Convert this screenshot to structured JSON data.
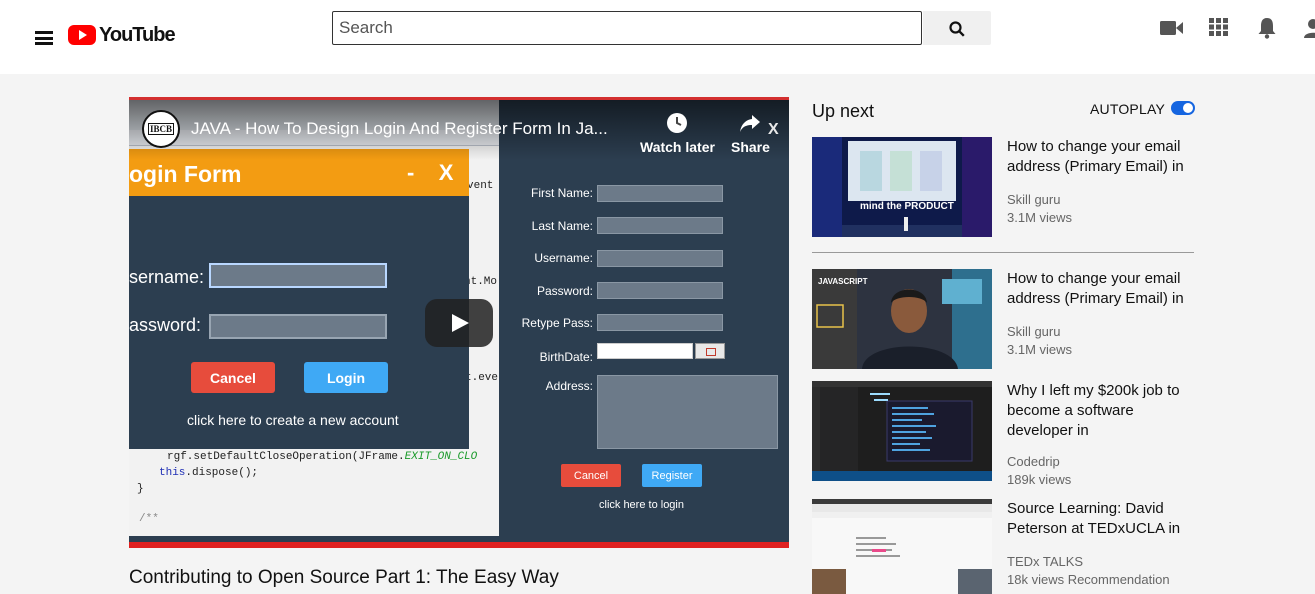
{
  "header": {
    "logo_text": "YouTube",
    "search_placeholder": "Search",
    "icons": [
      "menu-icon",
      "search-icon",
      "video-camera-icon",
      "apps-grid-icon",
      "bell-icon",
      "account-icon"
    ]
  },
  "player": {
    "video_title": "JAVA - How To Design Login And Register Form In Ja...",
    "channel_badge": "IBCB",
    "watch_later_label": "Watch later",
    "share_label": "Share",
    "close_label": "X",
    "ide_code": {
      "snippet1": "rgf.setDefaultCloseOperation(JFrame.",
      "snippet1_constant": "EXIT_ON_CLO",
      "snippet2_kw": "this",
      "snippet2_rest": ".dispose();",
      "snippet3": "}",
      "snippet4": "/**",
      "side1": "vent",
      "side2": "nt.Mo",
      "side3": "t.eve"
    },
    "login_form": {
      "title": "ogin Form",
      "window_controls": "-    X",
      "username_label": "sername:",
      "password_label": "assword:",
      "cancel_label": "Cancel",
      "login_label": "Login",
      "create_account_link": "click here to create a new account"
    },
    "register_form": {
      "first_name_label": "First Name:",
      "last_name_label": "Last Name:",
      "username_label": "Username:",
      "password_label": "Password:",
      "retype_pass_label": "Retype Pass:",
      "birthdate_label": "BirthDate:",
      "address_label": "Address:",
      "cancel_label": "Cancel",
      "register_label": "Register",
      "login_link": "click here to login"
    }
  },
  "main": {
    "video_title": "Contributing to Open Source Part 1: The Easy Way"
  },
  "sidebar": {
    "up_next_label": "Up next",
    "autoplay_label": "AUTOPLAY",
    "autoplay_on": true,
    "recommendations": [
      {
        "title": "How to change your email address (Primary Email) in",
        "channel": "Skill guru",
        "views": "3.1M views",
        "thumb_text": "mind the PRODUCT"
      },
      {
        "title": "How to change your email address (Primary Email) in",
        "channel": "Skill guru",
        "views": "3.1M views",
        "thumb_text": "JAVASCRIPT"
      },
      {
        "title": "Why I left my $200k job to become a software developer in",
        "channel": "Codedrip",
        "views": "189k views"
      },
      {
        "title": "Source Learning: David Peterson at TEDxUCLA in",
        "channel": "TEDx TALKS",
        "views": "18k views Recommendation"
      }
    ]
  },
  "colors": {
    "brand_red": "#ff0000",
    "autoplay_blue": "#1565e0",
    "form_orange": "#f39c12",
    "form_dark": "#2c3e50",
    "button_red": "#e74c3c",
    "button_blue": "#3fa9f5"
  }
}
